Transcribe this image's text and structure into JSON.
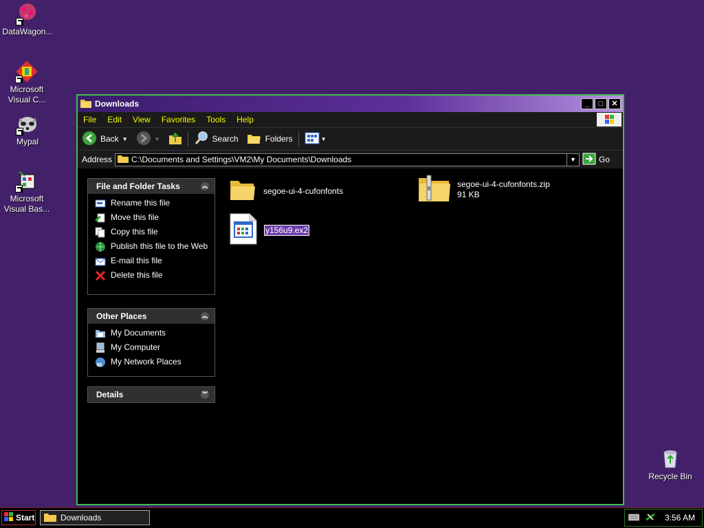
{
  "desktop": {
    "icons": [
      {
        "label": "DataWagon...",
        "icon": "datawagon-icon"
      },
      {
        "label": "Microsoft Visual C...",
        "icon": "visual-c-icon"
      },
      {
        "label": "Mypal",
        "icon": "mypal-icon"
      },
      {
        "label": "Microsoft Visual Bas...",
        "icon": "visual-basic-icon"
      },
      {
        "label": "Recycle Bin",
        "icon": "recycle-bin-icon"
      }
    ]
  },
  "window": {
    "title": "Downloads",
    "menu": [
      "File",
      "Edit",
      "View",
      "Favorites",
      "Tools",
      "Help"
    ],
    "toolbar": {
      "back": "Back",
      "search": "Search",
      "folders": "Folders"
    },
    "address": {
      "label": "Address",
      "path": "C:\\Documents and Settings\\VM2\\My Documents\\Downloads",
      "go": "Go"
    }
  },
  "tasks": {
    "file_folder": {
      "title": "File and Folder Tasks",
      "items": [
        "Rename this file",
        "Move this file",
        "Copy this file",
        "Publish this file to the Web",
        "E-mail this file",
        "Delete this file"
      ]
    },
    "other_places": {
      "title": "Other Places",
      "items": [
        "My Documents",
        "My Computer",
        "My Network Places"
      ]
    },
    "details": {
      "title": "Details"
    }
  },
  "files": [
    {
      "name": "segoe-ui-4-cufonfonts",
      "type": "folder",
      "size": ""
    },
    {
      "name": "segoe-ui-4-cufonfonts.zip",
      "type": "zip",
      "size": "91 KB"
    },
    {
      "name": "y156u9.ex2",
      "type": "program",
      "size": "",
      "renaming": true
    }
  ],
  "taskbar": {
    "start": "Start",
    "task": "Downloads",
    "clock": "3:56 AM"
  },
  "colors": {
    "desktop": "#43216a",
    "window_border": "#3fbf4f",
    "menu_text": "#f5ff00",
    "selection": "#6a3da8"
  }
}
